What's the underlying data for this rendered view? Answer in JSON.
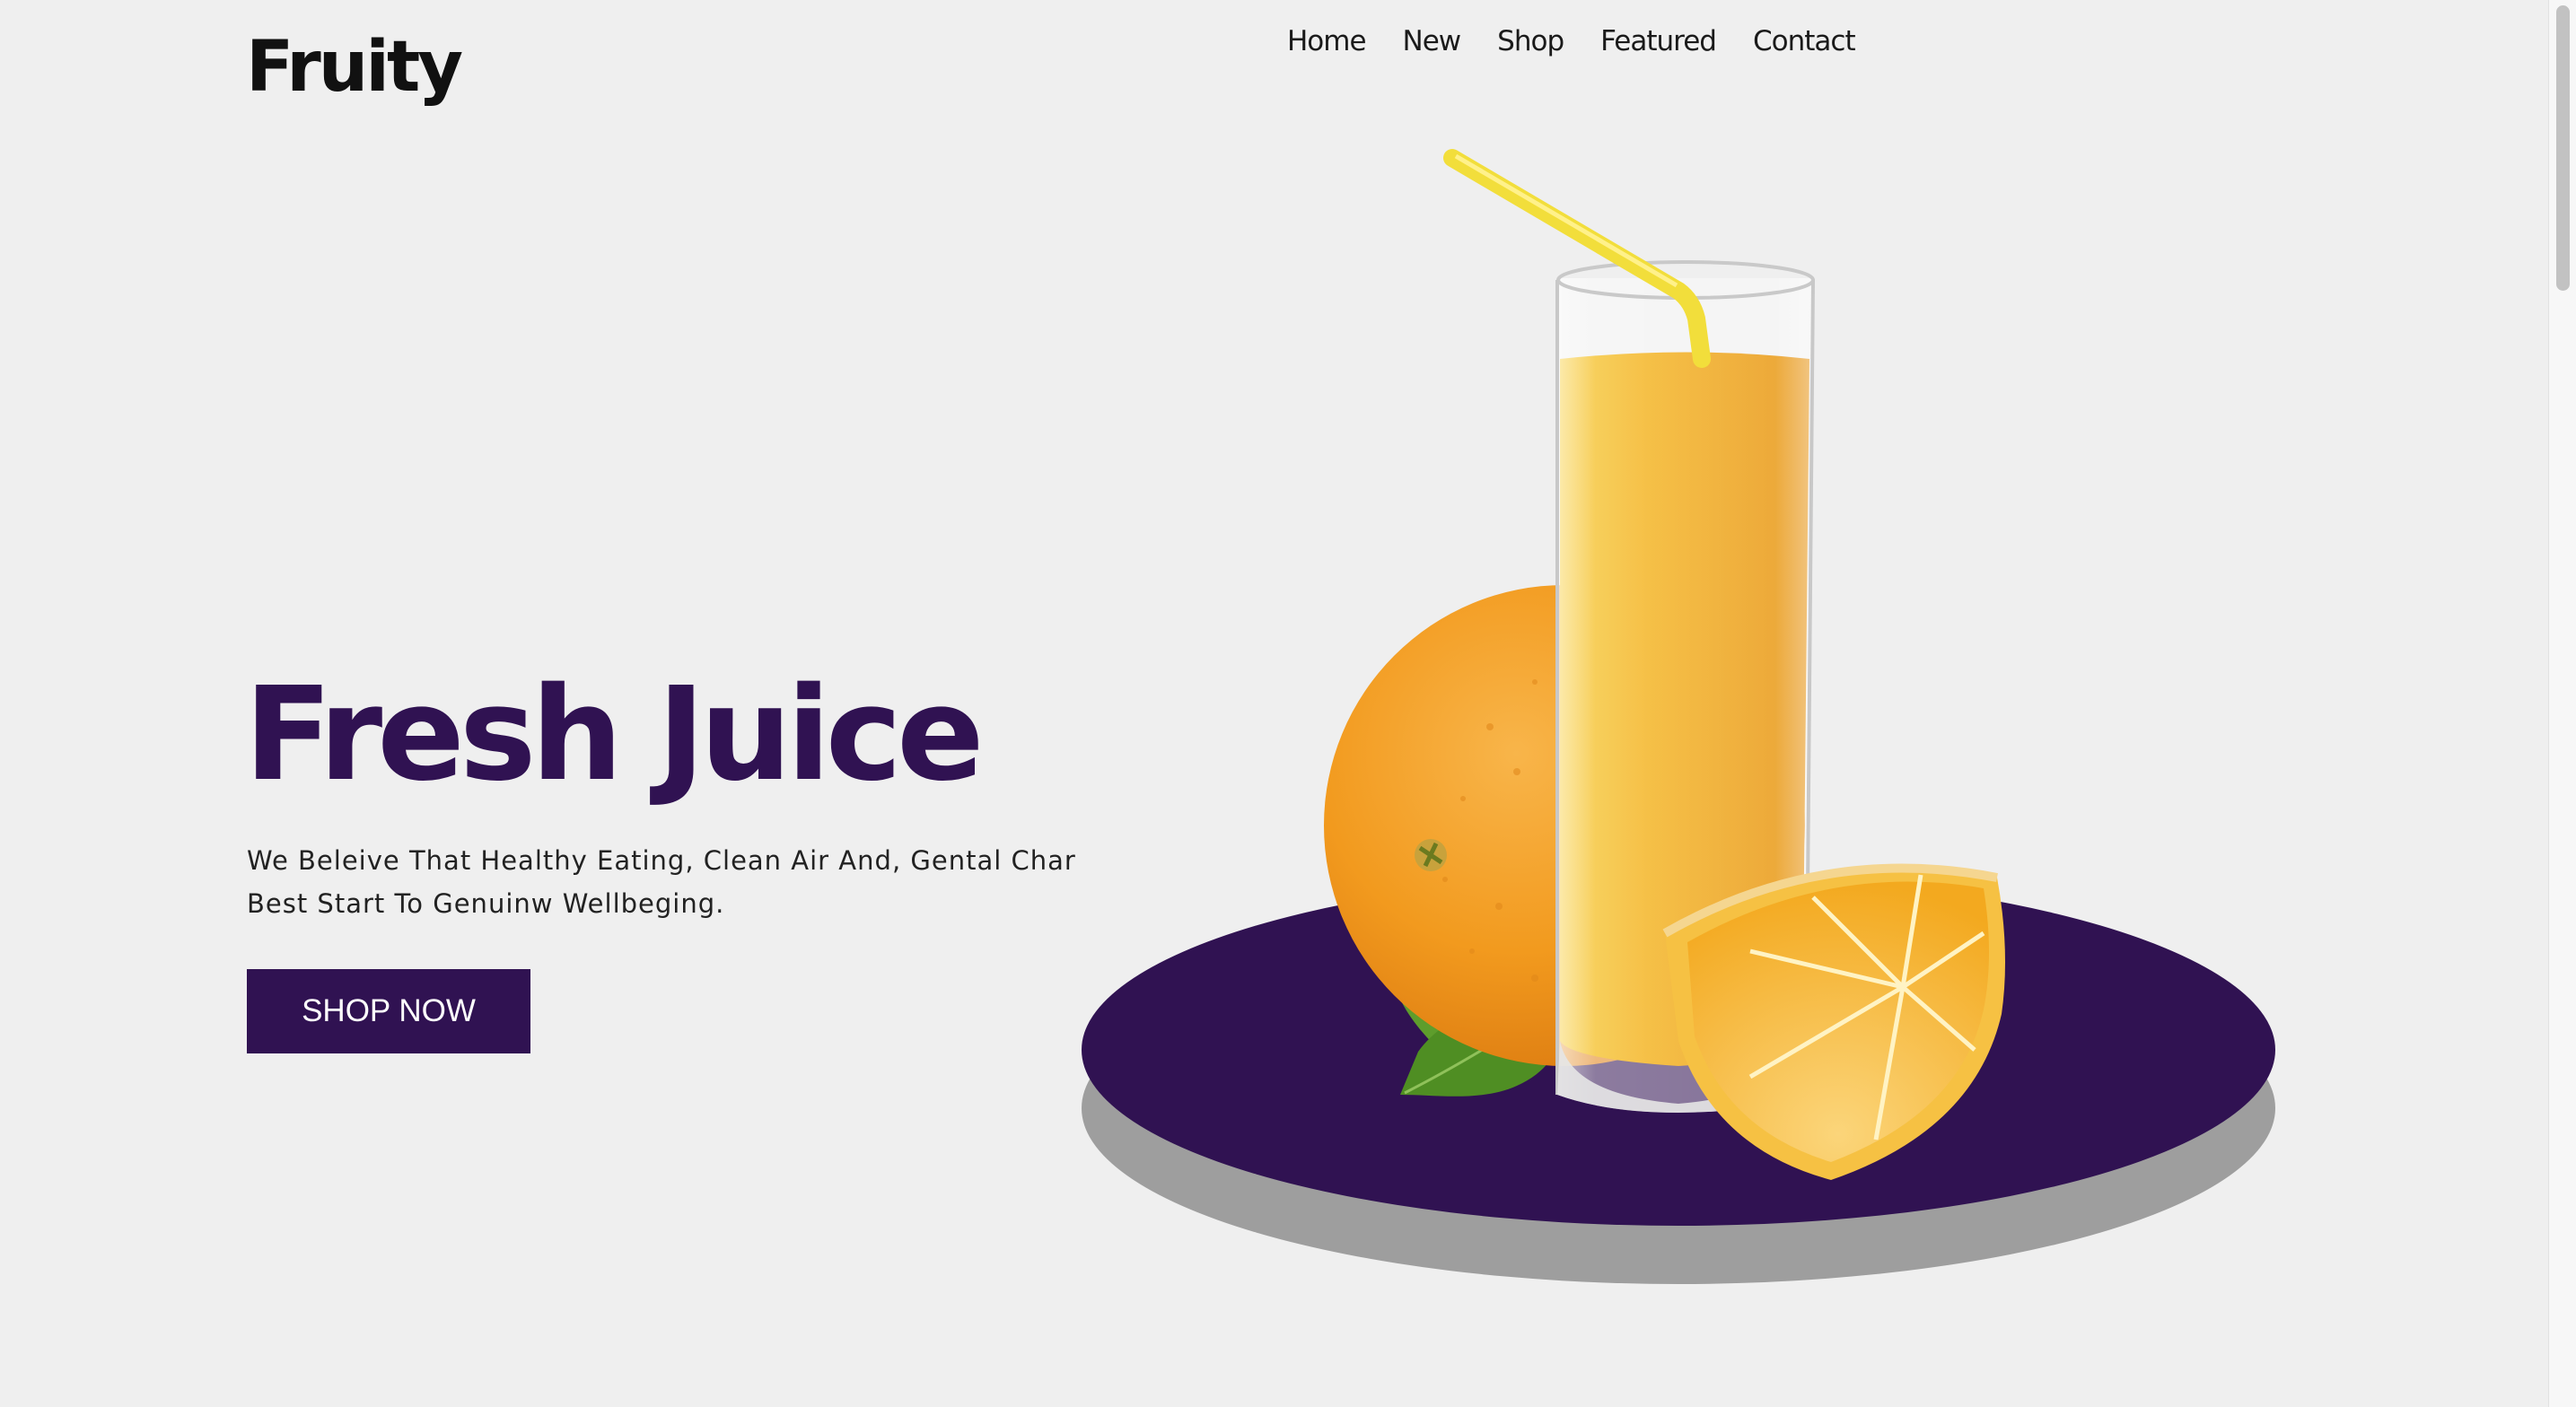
{
  "brand": {
    "logo_text": "Fruity"
  },
  "nav": {
    "items": [
      {
        "label": "Home"
      },
      {
        "label": "New"
      },
      {
        "label": "Shop"
      },
      {
        "label": "Featured"
      },
      {
        "label": "Contact"
      }
    ]
  },
  "hero": {
    "title": "Fresh Juice",
    "description": "We Beleive That Healthy Eating, Clean Air And, Gental Char Best Start To Genuinw Wellbeging.",
    "cta_label": "SHOP NOW"
  },
  "colors": {
    "accent": "#301252",
    "background": "#efefef",
    "juice": "#f3b12a",
    "orange": "#f19a1f",
    "leaf": "#5e9d2c",
    "plate_shadow": "#9e9e9e"
  },
  "icons": {
    "hero_image": "juice-glass-with-orange-illustration",
    "scrollbar": "vertical-scrollbar"
  }
}
